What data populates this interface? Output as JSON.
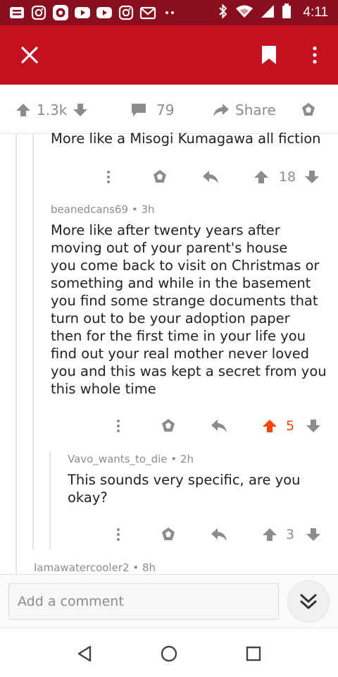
{
  "status_bar": {
    "time": "4:11",
    "left_icons": [
      "notification-app-icon",
      "instagram-icon",
      "app-icon",
      "youtube-icon",
      "youtube-icon",
      "instagram-icon",
      "gmail-icon",
      "more-dots-icon"
    ],
    "right_icons": [
      "bluetooth-icon",
      "wifi-icon",
      "signal-icon",
      "battery-icon"
    ]
  },
  "app_bar": {
    "close_icon": "close-icon",
    "bookmark_icon": "bookmark-icon",
    "menu_icon": "overflow-menu-icon"
  },
  "post_bar": {
    "score": "1.3k",
    "comments": "79",
    "share_label": "Share"
  },
  "comments": [
    {
      "text": "More like a Misogi Kumagawa all fiction",
      "score": "18"
    },
    {
      "author": "beanedcans69",
      "age": "3h",
      "lines": [
        "More like after twenty years after",
        "moving out of your parent's house",
        "you come back to visit on Christmas or",
        "something and while in the basement",
        "you find some strange documents that",
        "turn out to be your adoption paper",
        "then for the first time in your life you",
        "find out your real mother never loved",
        "you and this was kept a secret from you",
        "this whole time"
      ],
      "score": "5"
    },
    {
      "author": "Vavo_wants_to_die",
      "age": "2h",
      "lines": [
        "This sounds very specific, are you",
        "okay?"
      ],
      "score": "3"
    },
    {
      "author": "Iamawatercooler2",
      "age": "8h"
    }
  ],
  "meta_separator": "•",
  "comment_bar": {
    "placeholder": "Add a comment"
  },
  "colors": {
    "brand": "#c4101f",
    "status_bar": "#8a0e1e",
    "upvote": "#ff4500",
    "muted": "#8c8c8c"
  }
}
